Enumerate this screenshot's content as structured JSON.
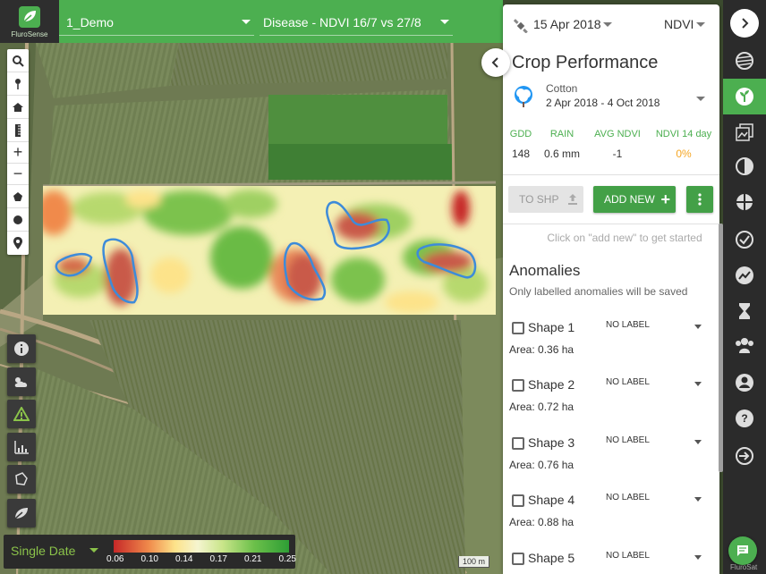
{
  "header": {
    "brand": "FluroSense",
    "farm_select": "1_Demo",
    "layer_select": "Disease - NDVI 16/7 vs 27/8"
  },
  "panel": {
    "date": "15 Apr 2018",
    "index": "NDVI",
    "title": "Crop Performance",
    "crop": {
      "name": "Cotton",
      "dates": "2 Apr 2018 - 4 Oct 2018"
    },
    "stats": [
      {
        "label": "GDD",
        "value": "148"
      },
      {
        "label": "RAIN",
        "value": "0.6 mm"
      },
      {
        "label": "AVG NDVI",
        "value": "-1"
      },
      {
        "label": "NDVI 14 day",
        "value": "0%"
      }
    ],
    "to_shp": "TO SHP",
    "add_new": "ADD NEW",
    "hint": "Click on \"add new\" to get started",
    "anomalies_title": "Anomalies",
    "anomalies_sub": "Only labelled anomalies will be saved",
    "shapes": [
      {
        "name": "Shape 1",
        "label": "NO LABEL",
        "area": "Area: 0.36 ha"
      },
      {
        "name": "Shape 2",
        "label": "NO LABEL",
        "area": "Area: 0.72 ha"
      },
      {
        "name": "Shape 3",
        "label": "NO LABEL",
        "area": "Area: 0.76 ha"
      },
      {
        "name": "Shape 4",
        "label": "NO LABEL",
        "area": "Area: 0.88 ha"
      },
      {
        "name": "Shape 5",
        "label": "NO LABEL",
        "area": ""
      }
    ]
  },
  "legend": {
    "mode": "Single Date",
    "ticks": [
      "0.06",
      "0.10",
      "0.14",
      "0.17",
      "0.21",
      "0.25"
    ],
    "scale": "100 m"
  },
  "footer": {
    "brand_small": "FluroSat"
  },
  "colors": {
    "accent": "#4caf50",
    "header": "#4caf50",
    "nav": "#2b2b2b",
    "ndvi_warning": "#f5a623"
  }
}
